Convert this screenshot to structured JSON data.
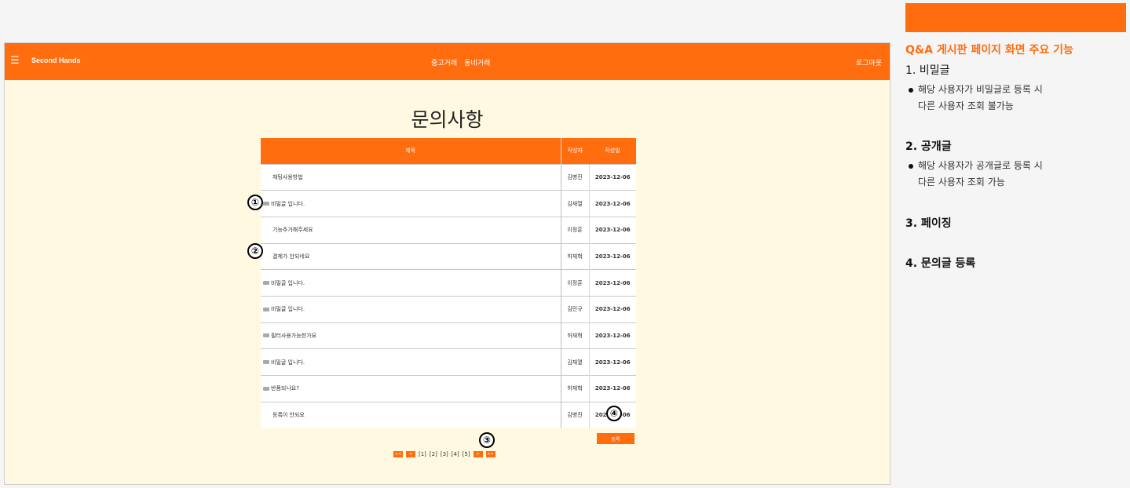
{
  "header": {
    "menu_icon": "☰",
    "brand": "Second Hands",
    "nav": [
      "중고거래",
      "동네거래"
    ],
    "logout": "로그아웃"
  },
  "page_title": "문의사항",
  "table": {
    "headers": {
      "title": "제목",
      "author": "작성자",
      "date": "작성일"
    },
    "rows": [
      {
        "title": "채팅사용방법",
        "author": "김병진",
        "date": "2023-12-06",
        "locked": false
      },
      {
        "title": "비밀글 입니다.",
        "author": "김재열",
        "date": "2023-12-06",
        "locked": true
      },
      {
        "title": "기능추가해주세요",
        "author": "이정훈",
        "date": "2023-12-06",
        "locked": false
      },
      {
        "title": "결제가 안되네요",
        "author": "허재혁",
        "date": "2023-12-06",
        "locked": false
      },
      {
        "title": "비밀글 입니다.",
        "author": "이정훈",
        "date": "2023-12-06",
        "locked": true
      },
      {
        "title": "비밀글 입니다.",
        "author": "김민규",
        "date": "2023-12-06",
        "locked": true
      },
      {
        "title": "필터사용가능한가요",
        "author": "허재혁",
        "date": "2023-12-06",
        "locked": true
      },
      {
        "title": "비밀글 입니다.",
        "author": "김재열",
        "date": "2023-12-06",
        "locked": true
      },
      {
        "title": "반품되나요?",
        "author": "허재혁",
        "date": "2023-12-06",
        "locked": true
      },
      {
        "title": "등록이 안되요",
        "author": "김병진",
        "date": "2023-12-06",
        "locked": false
      }
    ]
  },
  "register_label": "등록",
  "pagination": {
    "first": "<<",
    "prev": "<",
    "pages": [
      "[1]",
      "[2]",
      "[3]",
      "[4]",
      "[5]"
    ],
    "next": ">",
    "last": ">>"
  },
  "markers": [
    "①",
    "②",
    "③",
    "④"
  ],
  "annotations": {
    "title": "Q&A 게시판 페이지 화면 주요 기능",
    "item1": {
      "heading": "1. 비밀글",
      "line1": "해당 사용자가 비밀글로 등록 시",
      "line2": "다른 사용자 조회 불가능"
    },
    "item2": {
      "heading": "2. 공개글",
      "line1": "해당 사용자가 공개글로 등록 시",
      "line2": "다른 사용자 조회 가능"
    },
    "item3": {
      "heading": "3. 페이징"
    },
    "item4": {
      "heading": "4. 문의글 등록"
    }
  },
  "colors": {
    "accent": "#ff6d0f",
    "content_bg": "#fff9e1"
  }
}
